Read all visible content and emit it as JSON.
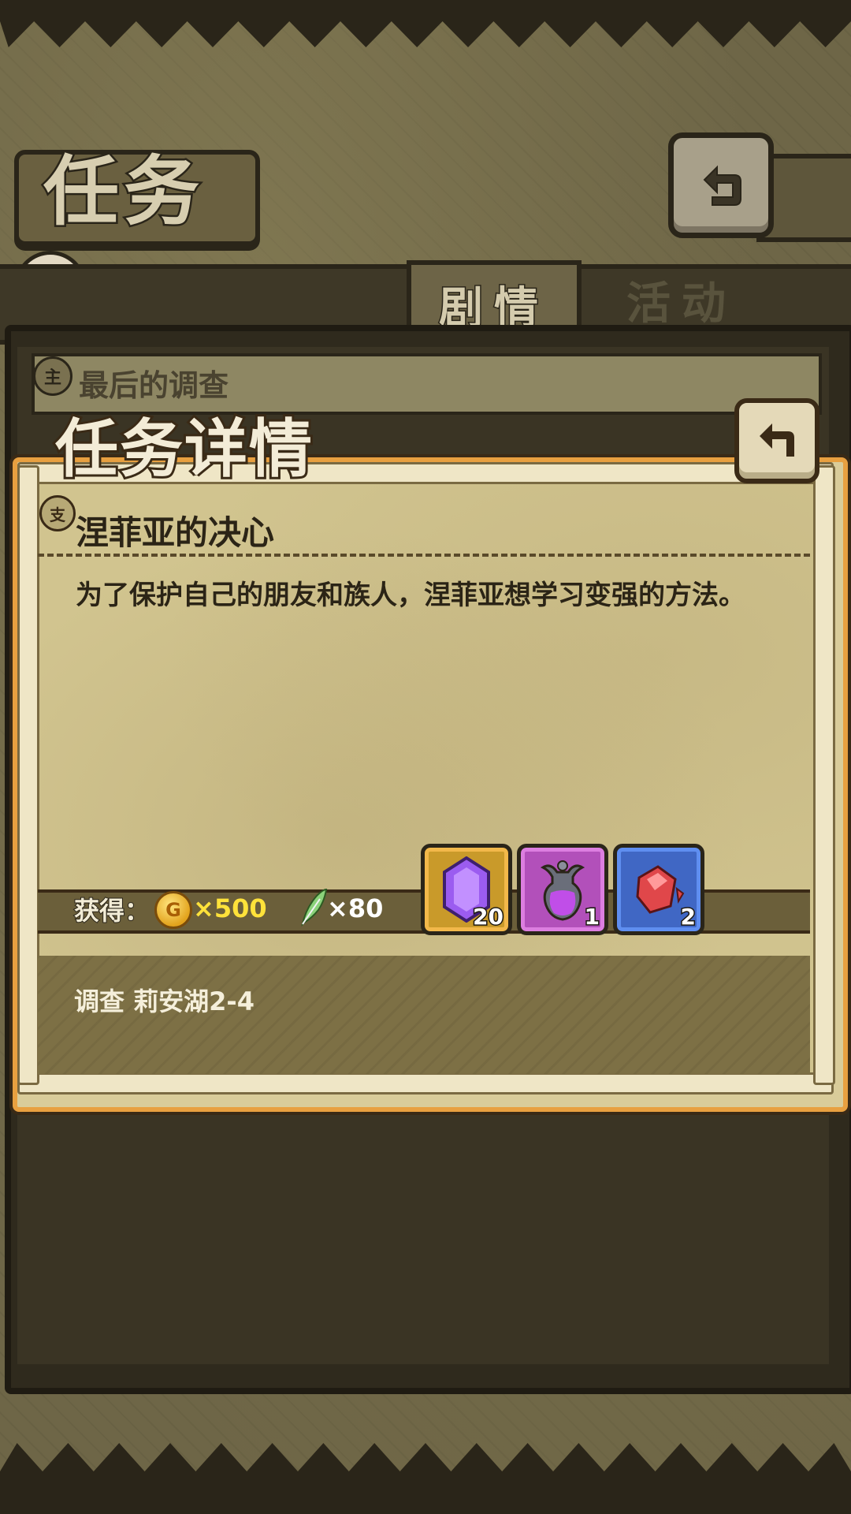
{
  "screen": {
    "title": "任务",
    "tabs": [
      {
        "label": "剧情",
        "active": true
      },
      {
        "label": "活动",
        "active": false
      }
    ]
  },
  "background_quest": {
    "badge": "主",
    "title": "最后的调查"
  },
  "dialog": {
    "title": "任务详情",
    "quest": {
      "badge": "支",
      "name": "涅菲亚的决心",
      "description": "为了保护自己的朋友和族人，涅菲亚想学习变强的方法。"
    },
    "rewards": {
      "label": "获得：",
      "coin_symbol": "G",
      "coin_amount": "×500",
      "feather_amount": "×80",
      "items": [
        {
          "icon": "purple-gem-icon",
          "qty": "20",
          "frame_color": "#f2b84a"
        },
        {
          "icon": "potion-vase-icon",
          "qty": "1",
          "frame_color": "#dc7ee0"
        },
        {
          "icon": "red-crystal-shard-icon",
          "qty": "2",
          "frame_color": "#5f8ef0"
        }
      ]
    },
    "condition": "调查 莉安湖2-4"
  },
  "colors": {
    "accent_orange": "#e8a040",
    "coin_text": "#ffe23a",
    "parchment": "#d9cc9a"
  }
}
